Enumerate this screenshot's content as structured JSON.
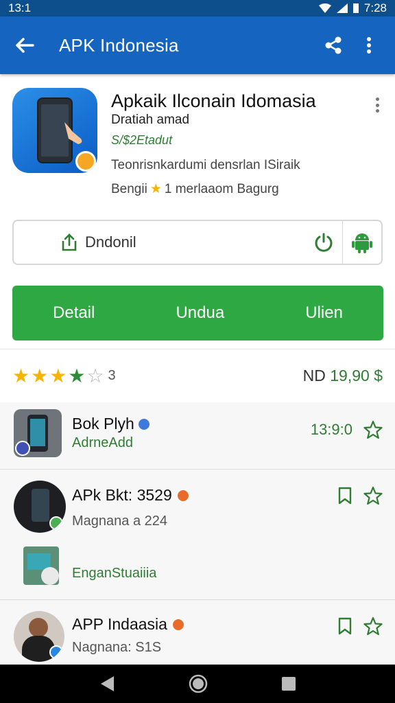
{
  "status": {
    "time": "13:1",
    "right_time": "7:28"
  },
  "appbar": {
    "title": "APK Indonesia"
  },
  "header": {
    "title": "Apkaik Ilconain Idomasia",
    "developer": "Dratiah amad",
    "tag": "S/$2Etadut",
    "description": "Teonrisnkardumi densrlan ISiraik",
    "meta_prefix": "Bengii",
    "meta_text": "1 merlaaom Bagurg"
  },
  "download": {
    "label": "Dndonil"
  },
  "green_bar": {
    "tab1": "Detail",
    "tab2": "Undua",
    "tab3": "Ulien"
  },
  "rating": {
    "count": "3",
    "filled": 3,
    "green": 1,
    "empty": 1
  },
  "price": {
    "prefix": "ND",
    "value": "19,90 $"
  },
  "items": [
    {
      "title": "Bok Plyh",
      "subtitle": "AdrneAdd",
      "price": "13:9:0"
    },
    {
      "title": "APk Bkt: 3529",
      "subtitle": "Magnana a 224"
    },
    {
      "title": "",
      "subtitle": "EnganStuaiiia"
    },
    {
      "title": "APP Indaasia",
      "subtitle": "Nagnana: S1S"
    }
  ],
  "colors": {
    "appbar": "#1565c0",
    "accent_green": "#2ea843",
    "star": "#f5b400"
  }
}
